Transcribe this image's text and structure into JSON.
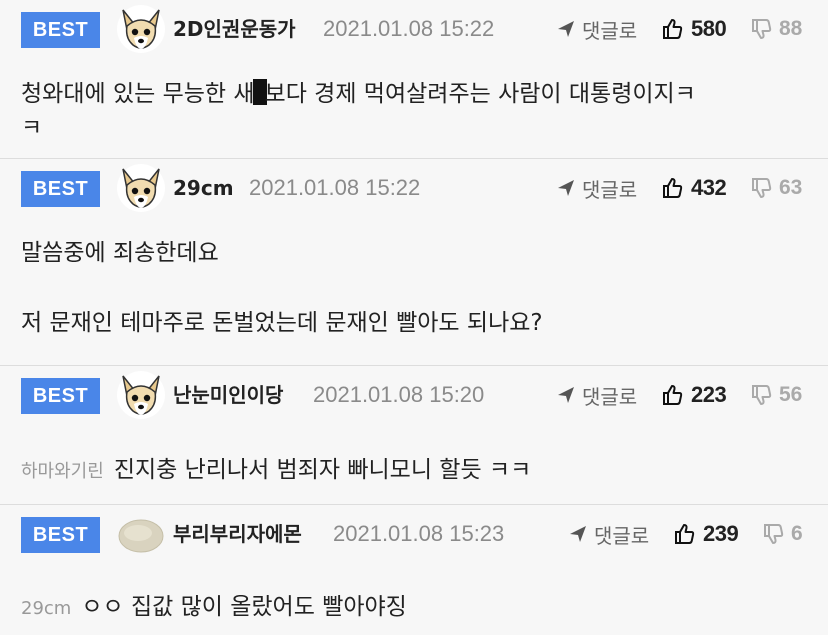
{
  "comments": [
    {
      "badge": "BEST",
      "author": "2D인권운동가",
      "time": "2021.01.08 15:22",
      "reply_label": "댓글로",
      "likes": "580",
      "dislikes": "88",
      "text_before": "청와대에 있는 무능한 새",
      "text_after": "보다 경제 먹여살려주는 사람이 대통령이지ㅋ",
      "text_line2": "ㅋ"
    },
    {
      "badge": "BEST",
      "author": "29cm",
      "time": "2021.01.08 15:22",
      "reply_label": "댓글로",
      "likes": "432",
      "dislikes": "63",
      "text_line1": "말씀중에 죄송한데요",
      "text_line2": "저 문재인 테마주로 돈벌었는데 문재인 빨아도 되나요?"
    },
    {
      "badge": "BEST",
      "author": "난눈미인이당",
      "time": "2021.01.08 15:20",
      "reply_label": "댓글로",
      "likes": "223",
      "dislikes": "56",
      "mention": "하마와기린",
      "text": "진지충 난리나서 범죄자 빠니모니 할듯 ㅋㅋ"
    },
    {
      "badge": "BEST",
      "author": "부리부리자에몬",
      "time": "2021.01.08 15:23",
      "reply_label": "댓글로",
      "likes": "239",
      "dislikes": "6",
      "mention": "29cm",
      "text": "ㅇㅇ 집값 많이 올랐어도 빨아야징"
    }
  ],
  "icons": {
    "reply": "paper-plane-icon",
    "like": "thumbs-up-icon",
    "dislike": "thumbs-down-icon",
    "avatar_dog": "chihuahua-avatar-icon",
    "avatar_round": "round-avatar-icon"
  },
  "colors": {
    "badge": "#4a86e8",
    "meta_text": "#8a8a8a",
    "dislike_count": "#aaaaaa",
    "divider": "#dddddd"
  }
}
